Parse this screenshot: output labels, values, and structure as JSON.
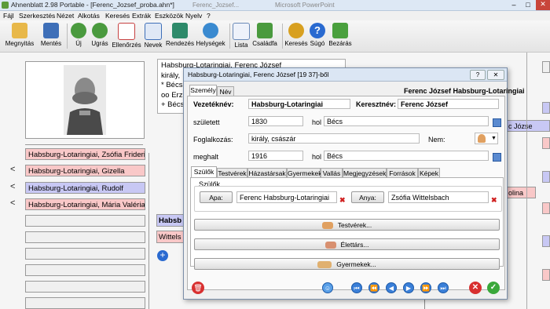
{
  "window": {
    "title": "Ahnenblatt 2.98 Portable - [Ferenc_Jozsef_proba.ahn*]",
    "bg_tabs": [
      "Ferenc_Jozsef...",
      "Microsoft PowerPoint"
    ]
  },
  "menu": [
    "Fájl",
    "Szerkesztés",
    "Nézet",
    "Alkotás",
    "Keresés",
    "Extrák",
    "Eszközök",
    "Nyelv",
    "?"
  ],
  "toolbar": [
    {
      "label": "Megnyitás",
      "icon": "folder-open-icon",
      "color": "#e8b84a"
    },
    {
      "label": "Mentés",
      "icon": "save-icon",
      "color": "#3e6fb8"
    },
    {
      "label": "Új",
      "icon": "new-person-icon",
      "color": "#4a9a3e"
    },
    {
      "label": "Ugrás",
      "icon": "jump-person-icon",
      "color": "#4a9a3e"
    },
    {
      "label": "Ellenőrzés",
      "icon": "checklist-icon",
      "color": "#c64040"
    },
    {
      "label": "Nevek",
      "icon": "names-icon",
      "color": "#3e6fb8"
    },
    {
      "label": "Rendezés",
      "icon": "sort-icon",
      "color": "#2e8a6a"
    },
    {
      "label": "Helységek",
      "icon": "globe-icon",
      "color": "#3a8ad0"
    },
    {
      "label": "Lista",
      "icon": "list-icon",
      "color": "#6a8ab8"
    },
    {
      "label": "Családfa",
      "icon": "family-tree-icon",
      "color": "#4a9a3e"
    },
    {
      "label": "Keresés",
      "icon": "search-icon",
      "color": "#d8a020"
    },
    {
      "label": "Súgó",
      "icon": "help-icon",
      "color": "#2a6ad0"
    },
    {
      "label": "Bezárás",
      "icon": "exit-icon",
      "color": "#4aa03e"
    }
  ],
  "left": {
    "persons": [
      {
        "name": "Habsburg-Lotaringiai, Zsófia Friderika",
        "kind": "pink",
        "arrow": ""
      },
      {
        "name": "Habsburg-Lotaringiai, Gizella",
        "kind": "pink",
        "arrow": "<"
      },
      {
        "name": "Habsburg-Lotaringiai, Rudolf",
        "kind": "blue",
        "arrow": "<"
      },
      {
        "name": "Habsburg-Lotaringiai, Mária Valéria",
        "kind": "pink",
        "arrow": "<"
      }
    ]
  },
  "center": {
    "notes_lines": [
      "Habsburg-Lotaringiai, Ferenc József",
      "király,",
      "* Bécs",
      "oo Erzs",
      "+ Bécs"
    ],
    "bold_label": "Habsb",
    "spouse_label": "Wittels",
    "right_labels": [
      "c Józse",
      "olina"
    ]
  },
  "dialog": {
    "title": "Habsburg-Lotaringiai, Ferenc József [19 37]-ből",
    "top_tabs": [
      "Személy",
      "Név"
    ],
    "header_name": "Ferenc József Habsburg-Lotaringiai",
    "vezeteknev_label": "Vezetéknév:",
    "vezeteknev": "Habsburg-Lotaringiai",
    "keresztnev_label": "Keresztnév:",
    "keresztnev": "Ferenc József",
    "szuletett_label": "született",
    "szuletett": "1830",
    "hol_label": "hol",
    "szuletett_hely": "Bécs",
    "foglalkozas_label": "Foglalkozás:",
    "foglalkozas": "király, császár",
    "nem_label": "Nem:",
    "meghalt_label": "meghalt",
    "meghalt": "1916",
    "meghalt_hely": "Bécs",
    "sub_tabs": [
      "Szülők",
      "Testvérek",
      "Házastársak",
      "Gyermekek",
      "Vallás",
      "Megjegyzések",
      "Források",
      "Képek"
    ],
    "szulok_group": "Szülők",
    "apa_button": "Apa:",
    "apa": "Ferenc Habsburg-Lotaringiai",
    "anya_button": "Anya:",
    "anya": "Zsófia Wittelsbach",
    "testverek_button": "Testvérek...",
    "elettars_button": "Élettárs...",
    "gyermekek_button": "Gyermekek...",
    "help_glyph": "?",
    "close_glyph": "✕"
  }
}
